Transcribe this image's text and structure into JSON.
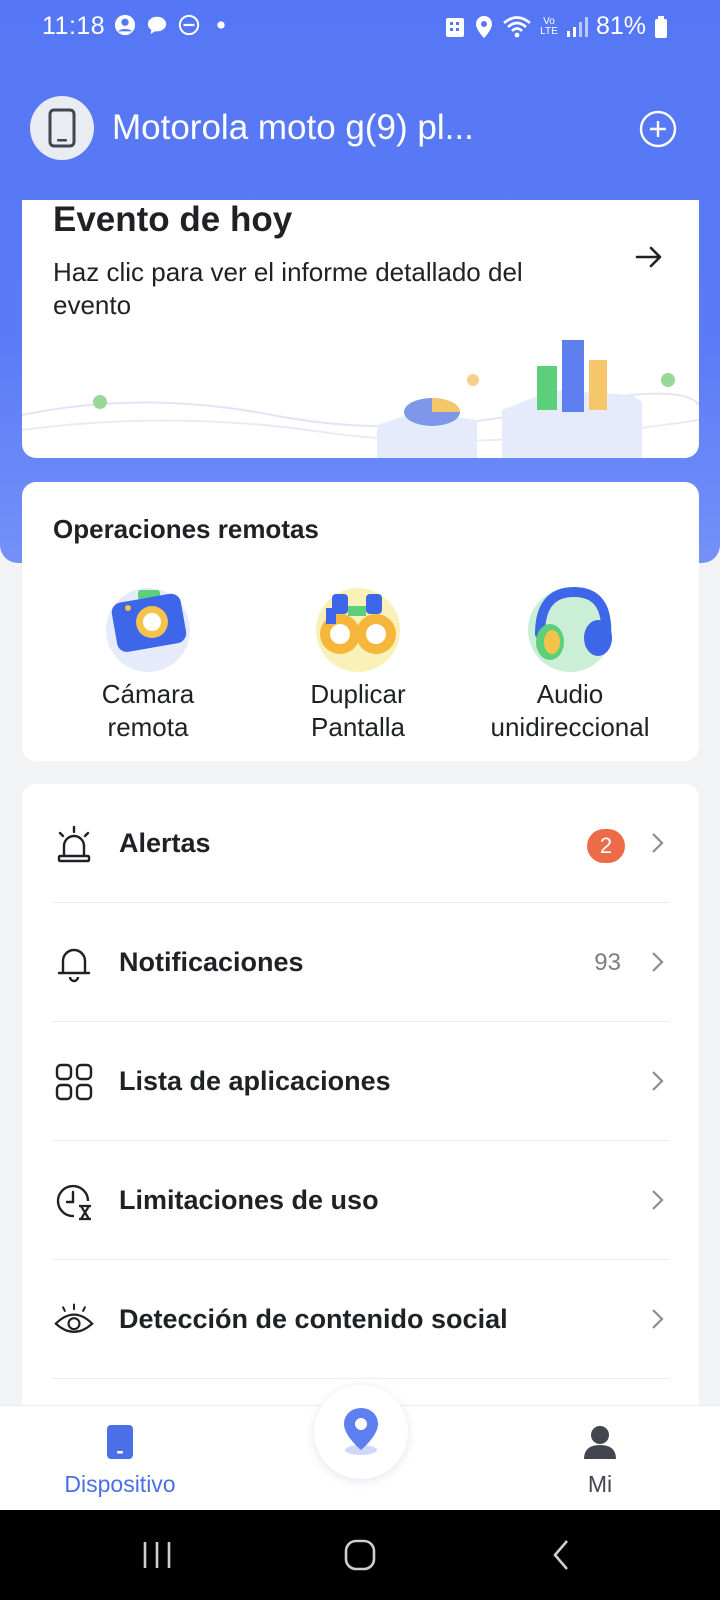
{
  "status_bar": {
    "time": "11:18",
    "battery": "81%",
    "network_label": "Vo LTE"
  },
  "device": {
    "name": "Motorola moto g(9) pl..."
  },
  "event_card": {
    "title": "Evento de hoy",
    "description": "Haz clic para ver el informe detallado del evento"
  },
  "remote_ops": {
    "title": "Operaciones remotas",
    "items": [
      {
        "label_line1": "Cámara",
        "label_line2": "remota",
        "icon": "camera-icon"
      },
      {
        "label_line1": "Duplicar",
        "label_line2": "Pantalla",
        "icon": "binoculars-icon"
      },
      {
        "label_line1": "Audio",
        "label_line2": "unidireccional",
        "icon": "headphones-icon"
      }
    ]
  },
  "menu": {
    "items": [
      {
        "label": "Alertas",
        "icon": "alarm-icon",
        "badge": "2"
      },
      {
        "label": "Notificaciones",
        "icon": "bell-icon",
        "count": "93"
      },
      {
        "label": "Lista de aplicaciones",
        "icon": "apps-grid-icon"
      },
      {
        "label": "Limitaciones de uso",
        "icon": "clock-hourglass-icon"
      },
      {
        "label": "Detección de contenido social",
        "icon": "eye-icon"
      }
    ]
  },
  "bottom_nav": {
    "device_label": "Dispositivo",
    "me_label": "Mi",
    "active": "Dispositivo"
  },
  "colors": {
    "brand_blue": "#5677f5",
    "badge_orange": "#ec6c4a",
    "active_nav": "#4a6fe6"
  }
}
